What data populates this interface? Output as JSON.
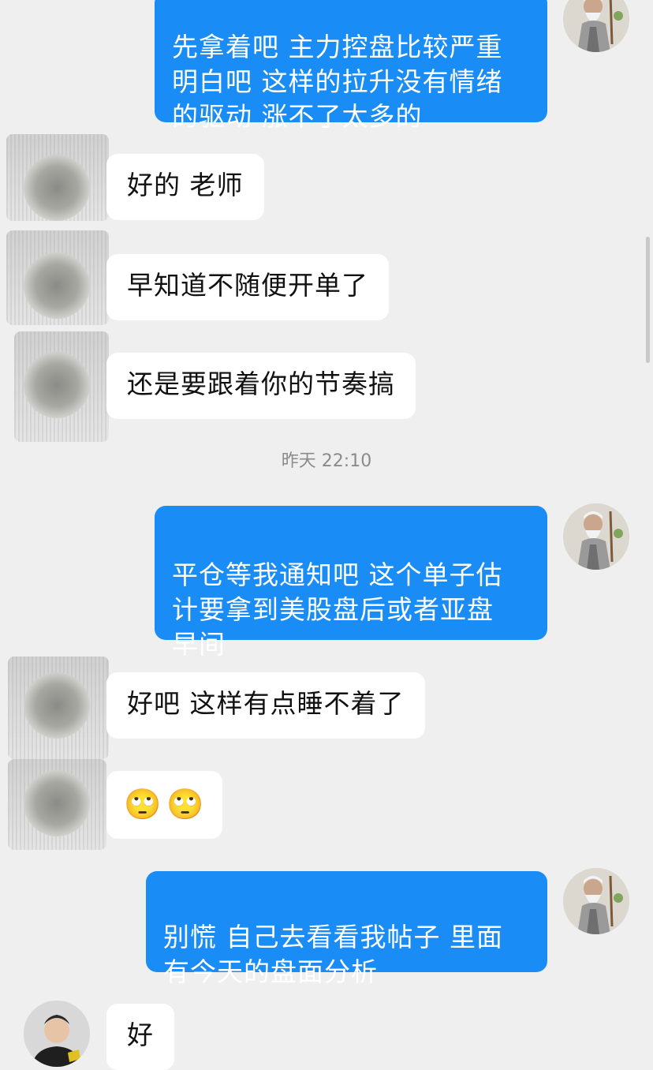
{
  "messages": [
    {
      "side": "out",
      "text": "先拿着吧 主力控盘比较严重\n明白吧 这样的拉升没有情绪\n的驱动 涨不了太多的"
    },
    {
      "side": "in",
      "text": "好的 老师"
    },
    {
      "side": "in",
      "text": "早知道不随便开单了"
    },
    {
      "side": "in",
      "text": "还是要跟着你的节奏搞"
    },
    {
      "side": "out",
      "text": "平仓等我通知吧 这个单子估\n计要拿到美股盘后或者亚盘\n早间"
    },
    {
      "side": "in",
      "text": "好吧 这样有点睡不着了"
    },
    {
      "side": "in",
      "emoji": [
        "🙄",
        "🙄"
      ]
    },
    {
      "side": "out",
      "text": "别慌 自己去看看我帖子 里面\n有今天的盘面分析"
    },
    {
      "side": "in",
      "text": "好"
    }
  ],
  "time_separator": "昨天 22:10",
  "colors": {
    "outgoing_bubble": "#1a8cf5",
    "incoming_bubble": "#ffffff",
    "background": "#efefef"
  },
  "icons": {
    "elder_avatar": "elder-avatar-icon",
    "user_avatar": "user-avatar-icon",
    "emoji": "eye-roll-emoji"
  }
}
